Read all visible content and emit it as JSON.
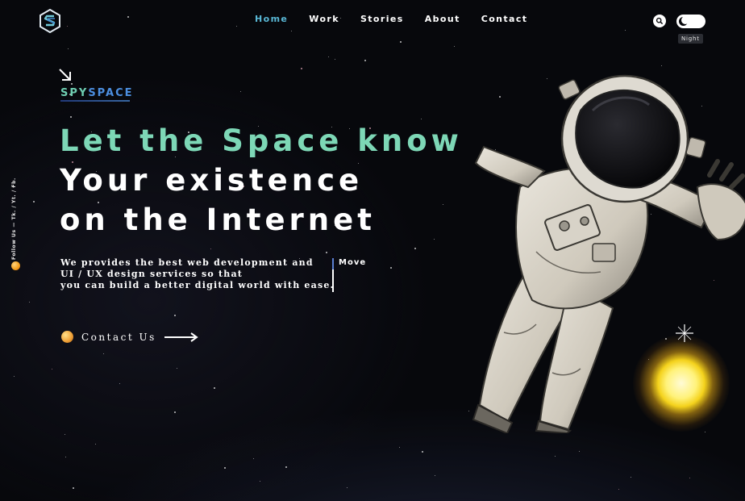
{
  "nav": {
    "items": [
      "Home",
      "Work",
      "Stories",
      "About",
      "Contact"
    ],
    "active": "Home"
  },
  "theme": {
    "tooltip": "Night"
  },
  "rail": {
    "text": "Follow Us — Tk. / Yt. / Fb."
  },
  "brand": {
    "spy": "SPY",
    "space": "SPACE"
  },
  "hero": {
    "line1": "Let the Space know",
    "line2": "Your existence",
    "line3": "on the Internet"
  },
  "description": [
    "We provides the best web development and",
    "UI / UX design services so that",
    "you can build a better digital world with ease."
  ],
  "move_label": "Move",
  "contact_label": "Contact Us",
  "colors": {
    "accent_green": "#7dd7b6",
    "nav_active": "#59b8d6",
    "brand_blue": "#4c8fe0",
    "background": "#07080c"
  },
  "icons": [
    "logo-icon",
    "search-icon",
    "theme-toggle",
    "arrow-down-right-icon",
    "planet-icon",
    "arrow-right-icon"
  ]
}
